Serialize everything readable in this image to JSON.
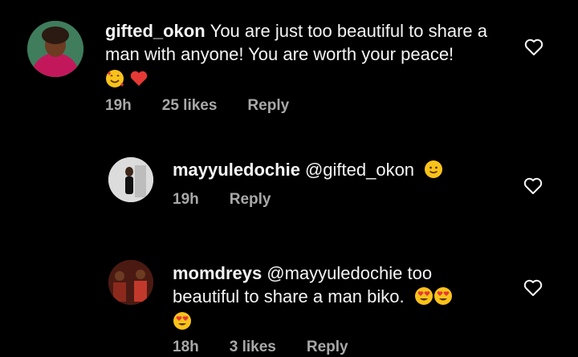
{
  "comments": [
    {
      "username": "gifted_okon",
      "text": "You are just too beautiful to share a man with anyone! You are worth your peace!",
      "time": "19h",
      "likes": "25 likes",
      "reply": "Reply",
      "emoji": [
        "smiling-face-with-hearts",
        "red-heart"
      ]
    },
    {
      "username": "mayyuledochie",
      "text": "@gifted_okon",
      "time": "19h",
      "reply": "Reply",
      "emoji": [
        "slightly-smiling-face"
      ]
    },
    {
      "username": "momdreys",
      "text": "@mayyuledochie too beautiful to share a man biko.",
      "time": "18h",
      "likes": "3 likes",
      "reply": "Reply",
      "emoji": [
        "heart-eyes-face",
        "heart-eyes-face",
        "heart-eyes-face"
      ]
    }
  ],
  "colors": {
    "background": "#000000",
    "text": "#f5f5f5",
    "meta": "#a8a8a8"
  }
}
